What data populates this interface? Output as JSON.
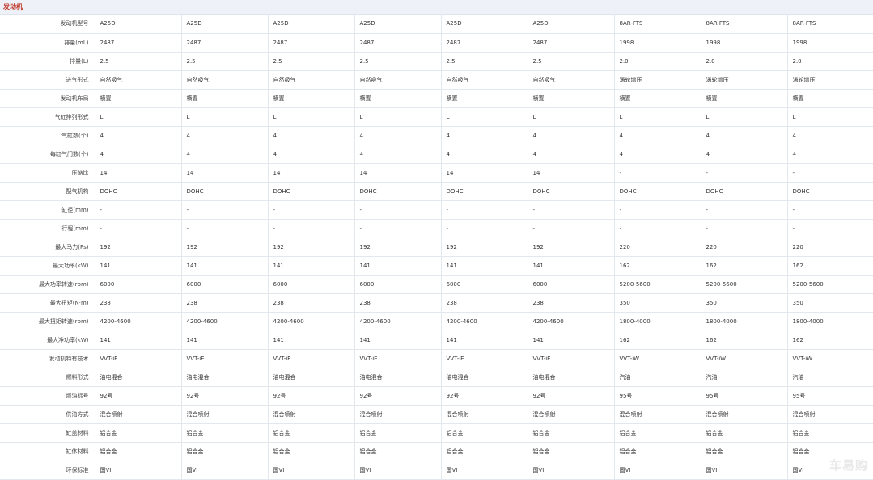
{
  "section": {
    "title": "发动机"
  },
  "watermark": "车易购",
  "rows": [
    {
      "label": "发动机型号",
      "values": [
        "A25D",
        "A25D",
        "A25D",
        "A25D",
        "A25D",
        "A25D",
        "8AR-FTS",
        "8AR-FTS",
        "8AR-FTS"
      ]
    },
    {
      "label": "排量(mL)",
      "values": [
        "2487",
        "2487",
        "2487",
        "2487",
        "2487",
        "2487",
        "1998",
        "1998",
        "1998"
      ]
    },
    {
      "label": "排量(L)",
      "values": [
        "2.5",
        "2.5",
        "2.5",
        "2.5",
        "2.5",
        "2.5",
        "2.0",
        "2.0",
        "2.0"
      ]
    },
    {
      "label": "进气形式",
      "values": [
        "自然吸气",
        "自然吸气",
        "自然吸气",
        "自然吸气",
        "自然吸气",
        "自然吸气",
        "涡轮增压",
        "涡轮增压",
        "涡轮增压"
      ]
    },
    {
      "label": "发动机布局",
      "values": [
        "横置",
        "横置",
        "横置",
        "横置",
        "横置",
        "横置",
        "横置",
        "横置",
        "横置"
      ]
    },
    {
      "label": "气缸排列形式",
      "values": [
        "L",
        "L",
        "L",
        "L",
        "L",
        "L",
        "L",
        "L",
        "L"
      ]
    },
    {
      "label": "气缸数(个)",
      "values": [
        "4",
        "4",
        "4",
        "4",
        "4",
        "4",
        "4",
        "4",
        "4"
      ]
    },
    {
      "label": "每缸气门数(个)",
      "values": [
        "4",
        "4",
        "4",
        "4",
        "4",
        "4",
        "4",
        "4",
        "4"
      ]
    },
    {
      "label": "压缩比",
      "values": [
        "14",
        "14",
        "14",
        "14",
        "14",
        "14",
        "-",
        "-",
        "-"
      ]
    },
    {
      "label": "配气机构",
      "values": [
        "DOHC",
        "DOHC",
        "DOHC",
        "DOHC",
        "DOHC",
        "DOHC",
        "DOHC",
        "DOHC",
        "DOHC"
      ]
    },
    {
      "label": "缸径(mm)",
      "values": [
        "-",
        "-",
        "-",
        "-",
        "-",
        "-",
        "-",
        "-",
        "-"
      ]
    },
    {
      "label": "行程(mm)",
      "values": [
        "-",
        "-",
        "-",
        "-",
        "-",
        "-",
        "-",
        "-",
        "-"
      ]
    },
    {
      "label": "最大马力(Ps)",
      "values": [
        "192",
        "192",
        "192",
        "192",
        "192",
        "192",
        "220",
        "220",
        "220"
      ]
    },
    {
      "label": "最大功率(kW)",
      "values": [
        "141",
        "141",
        "141",
        "141",
        "141",
        "141",
        "162",
        "162",
        "162"
      ]
    },
    {
      "label": "最大功率转速(rpm)",
      "values": [
        "6000",
        "6000",
        "6000",
        "6000",
        "6000",
        "6000",
        "5200-5600",
        "5200-5600",
        "5200-5600"
      ]
    },
    {
      "label": "最大扭矩(N·m)",
      "values": [
        "238",
        "238",
        "238",
        "238",
        "238",
        "238",
        "350",
        "350",
        "350"
      ]
    },
    {
      "label": "最大扭矩转速(rpm)",
      "values": [
        "4200-4600",
        "4200-4600",
        "4200-4600",
        "4200-4600",
        "4200-4600",
        "4200-4600",
        "1800-4000",
        "1800-4000",
        "1800-4000"
      ]
    },
    {
      "label": "最大净功率(kW)",
      "values": [
        "141",
        "141",
        "141",
        "141",
        "141",
        "141",
        "162",
        "162",
        "162"
      ]
    },
    {
      "label": "发动机特有技术",
      "values": [
        "VVT-iE",
        "VVT-iE",
        "VVT-iE",
        "VVT-iE",
        "VVT-iE",
        "VVT-iE",
        "VVT-iW",
        "VVT-iW",
        "VVT-iW"
      ]
    },
    {
      "label": "燃料形式",
      "values": [
        "油电混合",
        "油电混合",
        "油电混合",
        "油电混合",
        "油电混合",
        "油电混合",
        "汽油",
        "汽油",
        "汽油"
      ]
    },
    {
      "label": "燃油标号",
      "values": [
        "92号",
        "92号",
        "92号",
        "92号",
        "92号",
        "92号",
        "95号",
        "95号",
        "95号"
      ]
    },
    {
      "label": "供油方式",
      "values": [
        "混合喷射",
        "混合喷射",
        "混合喷射",
        "混合喷射",
        "混合喷射",
        "混合喷射",
        "混合喷射",
        "混合喷射",
        "混合喷射"
      ]
    },
    {
      "label": "缸盖材料",
      "values": [
        "铝合金",
        "铝合金",
        "铝合金",
        "铝合金",
        "铝合金",
        "铝合金",
        "铝合金",
        "铝合金",
        "铝合金"
      ]
    },
    {
      "label": "缸体材料",
      "values": [
        "铝合金",
        "铝合金",
        "铝合金",
        "铝合金",
        "铝合金",
        "铝合金",
        "铝合金",
        "铝合金",
        "铝合金"
      ]
    },
    {
      "label": "环保标准",
      "values": [
        "国VI",
        "国VI",
        "国VI",
        "国VI",
        "国VI",
        "国VI",
        "国VI",
        "国VI",
        "国VI"
      ]
    }
  ]
}
